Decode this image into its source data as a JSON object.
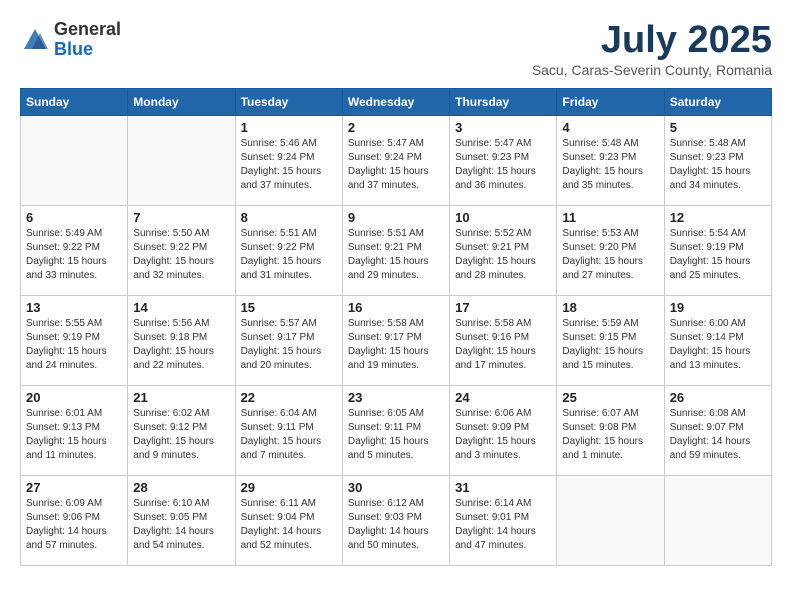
{
  "header": {
    "logo_general": "General",
    "logo_blue": "Blue",
    "month_title": "July 2025",
    "subtitle": "Sacu, Caras-Severin County, Romania"
  },
  "days_of_week": [
    "Sunday",
    "Monday",
    "Tuesday",
    "Wednesday",
    "Thursday",
    "Friday",
    "Saturday"
  ],
  "weeks": [
    [
      {
        "num": "",
        "info": ""
      },
      {
        "num": "",
        "info": ""
      },
      {
        "num": "1",
        "info": "Sunrise: 5:46 AM\nSunset: 9:24 PM\nDaylight: 15 hours and 37 minutes."
      },
      {
        "num": "2",
        "info": "Sunrise: 5:47 AM\nSunset: 9:24 PM\nDaylight: 15 hours and 37 minutes."
      },
      {
        "num": "3",
        "info": "Sunrise: 5:47 AM\nSunset: 9:23 PM\nDaylight: 15 hours and 36 minutes."
      },
      {
        "num": "4",
        "info": "Sunrise: 5:48 AM\nSunset: 9:23 PM\nDaylight: 15 hours and 35 minutes."
      },
      {
        "num": "5",
        "info": "Sunrise: 5:48 AM\nSunset: 9:23 PM\nDaylight: 15 hours and 34 minutes."
      }
    ],
    [
      {
        "num": "6",
        "info": "Sunrise: 5:49 AM\nSunset: 9:22 PM\nDaylight: 15 hours and 33 minutes."
      },
      {
        "num": "7",
        "info": "Sunrise: 5:50 AM\nSunset: 9:22 PM\nDaylight: 15 hours and 32 minutes."
      },
      {
        "num": "8",
        "info": "Sunrise: 5:51 AM\nSunset: 9:22 PM\nDaylight: 15 hours and 31 minutes."
      },
      {
        "num": "9",
        "info": "Sunrise: 5:51 AM\nSunset: 9:21 PM\nDaylight: 15 hours and 29 minutes."
      },
      {
        "num": "10",
        "info": "Sunrise: 5:52 AM\nSunset: 9:21 PM\nDaylight: 15 hours and 28 minutes."
      },
      {
        "num": "11",
        "info": "Sunrise: 5:53 AM\nSunset: 9:20 PM\nDaylight: 15 hours and 27 minutes."
      },
      {
        "num": "12",
        "info": "Sunrise: 5:54 AM\nSunset: 9:19 PM\nDaylight: 15 hours and 25 minutes."
      }
    ],
    [
      {
        "num": "13",
        "info": "Sunrise: 5:55 AM\nSunset: 9:19 PM\nDaylight: 15 hours and 24 minutes."
      },
      {
        "num": "14",
        "info": "Sunrise: 5:56 AM\nSunset: 9:18 PM\nDaylight: 15 hours and 22 minutes."
      },
      {
        "num": "15",
        "info": "Sunrise: 5:57 AM\nSunset: 9:17 PM\nDaylight: 15 hours and 20 minutes."
      },
      {
        "num": "16",
        "info": "Sunrise: 5:58 AM\nSunset: 9:17 PM\nDaylight: 15 hours and 19 minutes."
      },
      {
        "num": "17",
        "info": "Sunrise: 5:58 AM\nSunset: 9:16 PM\nDaylight: 15 hours and 17 minutes."
      },
      {
        "num": "18",
        "info": "Sunrise: 5:59 AM\nSunset: 9:15 PM\nDaylight: 15 hours and 15 minutes."
      },
      {
        "num": "19",
        "info": "Sunrise: 6:00 AM\nSunset: 9:14 PM\nDaylight: 15 hours and 13 minutes."
      }
    ],
    [
      {
        "num": "20",
        "info": "Sunrise: 6:01 AM\nSunset: 9:13 PM\nDaylight: 15 hours and 11 minutes."
      },
      {
        "num": "21",
        "info": "Sunrise: 6:02 AM\nSunset: 9:12 PM\nDaylight: 15 hours and 9 minutes."
      },
      {
        "num": "22",
        "info": "Sunrise: 6:04 AM\nSunset: 9:11 PM\nDaylight: 15 hours and 7 minutes."
      },
      {
        "num": "23",
        "info": "Sunrise: 6:05 AM\nSunset: 9:11 PM\nDaylight: 15 hours and 5 minutes."
      },
      {
        "num": "24",
        "info": "Sunrise: 6:06 AM\nSunset: 9:09 PM\nDaylight: 15 hours and 3 minutes."
      },
      {
        "num": "25",
        "info": "Sunrise: 6:07 AM\nSunset: 9:08 PM\nDaylight: 15 hours and 1 minute."
      },
      {
        "num": "26",
        "info": "Sunrise: 6:08 AM\nSunset: 9:07 PM\nDaylight: 14 hours and 59 minutes."
      }
    ],
    [
      {
        "num": "27",
        "info": "Sunrise: 6:09 AM\nSunset: 9:06 PM\nDaylight: 14 hours and 57 minutes."
      },
      {
        "num": "28",
        "info": "Sunrise: 6:10 AM\nSunset: 9:05 PM\nDaylight: 14 hours and 54 minutes."
      },
      {
        "num": "29",
        "info": "Sunrise: 6:11 AM\nSunset: 9:04 PM\nDaylight: 14 hours and 52 minutes."
      },
      {
        "num": "30",
        "info": "Sunrise: 6:12 AM\nSunset: 9:03 PM\nDaylight: 14 hours and 50 minutes."
      },
      {
        "num": "31",
        "info": "Sunrise: 6:14 AM\nSunset: 9:01 PM\nDaylight: 14 hours and 47 minutes."
      },
      {
        "num": "",
        "info": ""
      },
      {
        "num": "",
        "info": ""
      }
    ]
  ]
}
